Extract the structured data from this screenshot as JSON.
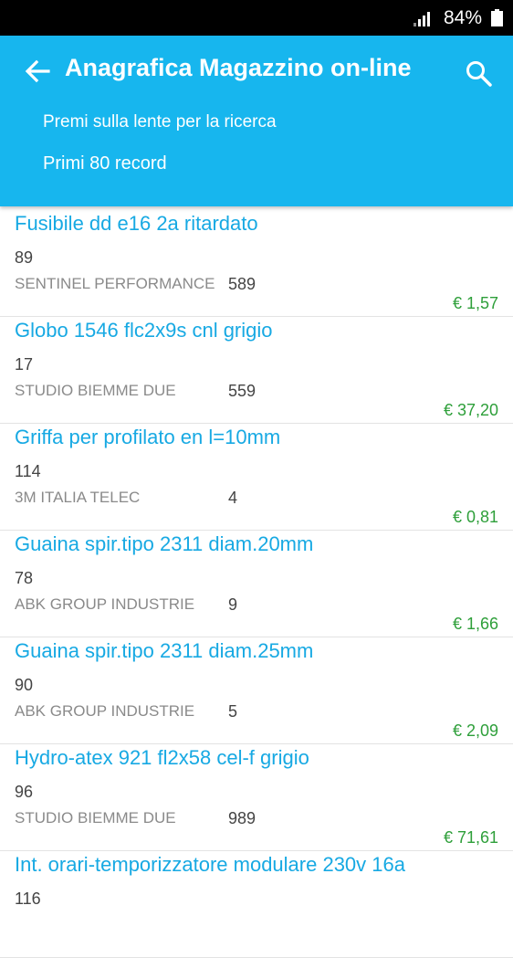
{
  "status_bar": {
    "battery": "84%"
  },
  "app_bar": {
    "title": "Anagrafica Magazzino on-line",
    "hint_search": "Premi sulla lente per la ricerca",
    "hint_records": "Primi 80 record"
  },
  "items": [
    {
      "title": "Fusibile dd e16  2a ritardato",
      "qty": "89",
      "supplier": "SENTINEL PERFORMANCE",
      "code": "589",
      "price": "€ 1,57"
    },
    {
      "title": "Globo 1546 flc2x9s cnl grigio",
      "qty": "17",
      "supplier": "STUDIO BIEMME DUE",
      "code": "559",
      "price": "€ 37,20"
    },
    {
      "title": "Griffa per profilato en l=10mm",
      "qty": "114",
      "supplier": "3M ITALIA TELEC",
      "code": "4",
      "price": "€ 0,81"
    },
    {
      "title": "Guaina spir.tipo 2311 diam.20mm",
      "qty": "78",
      "supplier": "ABK GROUP INDUSTRIE",
      "code": "9",
      "price": "€ 1,66"
    },
    {
      "title": "Guaina spir.tipo 2311 diam.25mm",
      "qty": "90",
      "supplier": "ABK GROUP INDUSTRIE",
      "code": "5",
      "price": "€ 2,09"
    },
    {
      "title": "Hydro-atex 921 fl2x58 cel-f grigio",
      "qty": "96",
      "supplier": "STUDIO BIEMME DUE",
      "code": "989",
      "price": "€ 71,61"
    },
    {
      "title": "Int. orari-temporizzatore modulare 230v 16a",
      "qty": "116",
      "supplier": "",
      "code": "",
      "price": ""
    }
  ]
}
